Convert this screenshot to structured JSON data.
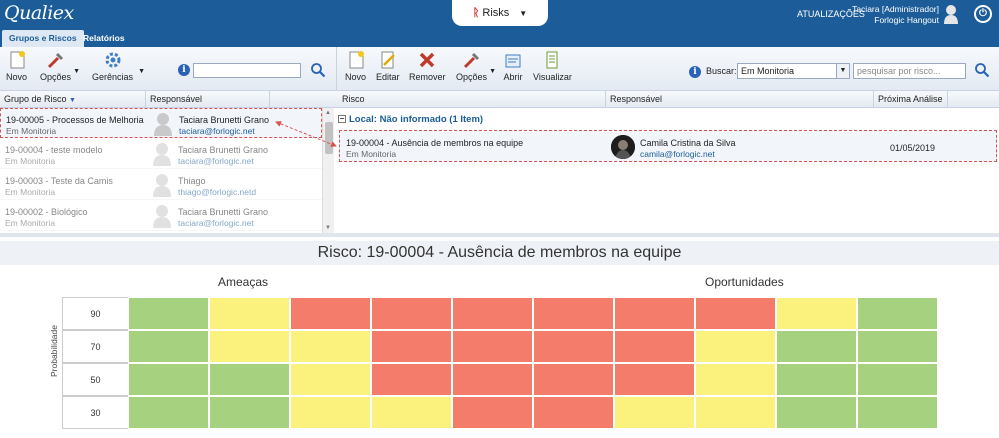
{
  "app": {
    "logo": "Qualiex",
    "module": "Risks",
    "updates": "ATUALIZAÇÕES",
    "user_line1": "Taciara [Administrador]",
    "user_line2": "Forlogic Hangout"
  },
  "tabs": [
    {
      "label": "Grupos e Riscos"
    },
    {
      "label": "Relatórios"
    }
  ],
  "left_toolbar": {
    "novo": "Novo",
    "opcoes": "Opções",
    "gerencias": "Gerências",
    "search_value": ""
  },
  "right_toolbar": {
    "novo": "Novo",
    "editar": "Editar",
    "remover": "Remover",
    "opcoes": "Opções",
    "abrir": "Abrir",
    "visualizar": "Visualizar",
    "buscar_label": "Buscar:",
    "buscar_select": "Em Monitoria",
    "search_placeholder": "pesquisar por risco..."
  },
  "left_columns": {
    "group": "Grupo de Risco",
    "responsavel": "Responsável"
  },
  "left_rows": [
    {
      "code": "19-00005 - Processos de Melhoria",
      "status": "Em Monitoria",
      "name": "Taciara Brunetti Grano",
      "email": "taciara@forlogic.net"
    },
    {
      "code": "19-00004 - teste modelo",
      "status": "Em Monitoria",
      "name": "Taciara Brunetti Grano",
      "email": "taciara@forlogic.net"
    },
    {
      "code": "19-00003 - Teste da Camis",
      "status": "Em Monitoria",
      "name": "Thiago",
      "email": "thiago@forlogic.netd"
    },
    {
      "code": "19-00002 - Biológico",
      "status": "Em Monitoria",
      "name": "Taciara Brunetti Grano",
      "email": "taciara@forlogic.net"
    }
  ],
  "right_columns": {
    "risco": "Risco",
    "responsavel": "Responsável",
    "proxima": "Próxima Análise"
  },
  "group_label": "Local: Não informado (1 Item)",
  "right_row": {
    "code": "19-00004 - Ausência de membros na equipe",
    "status": "Em Monitoria",
    "name": "Camila Cristina da Silva",
    "email": "camila@forlogic.net",
    "date": "01/05/2019"
  },
  "chart": {
    "title": "Risco: 19-00004 - Ausência de membros na equipe",
    "threats_label": "Ameaças",
    "opps_label": "Oportunidades",
    "y_axis": "Probabilidade",
    "y_ticks": [
      "90",
      "70",
      "50",
      "30"
    ],
    "colors": {
      "green": "#a6d17f",
      "yellow": "#fbf27e",
      "red": "#f47c6b"
    },
    "matrix": [
      [
        "green",
        "yellow",
        "red",
        "red",
        "red",
        "red",
        "red",
        "red",
        "yellow",
        "green"
      ],
      [
        "green",
        "yellow",
        "yellow",
        "red",
        "red",
        "red",
        "red",
        "yellow",
        "green",
        "green"
      ],
      [
        "green",
        "green",
        "yellow",
        "red",
        "red",
        "red",
        "red",
        "yellow",
        "green",
        "green"
      ],
      [
        "green",
        "green",
        "yellow",
        "yellow",
        "red",
        "red",
        "yellow",
        "yellow",
        "green",
        "green"
      ]
    ]
  }
}
